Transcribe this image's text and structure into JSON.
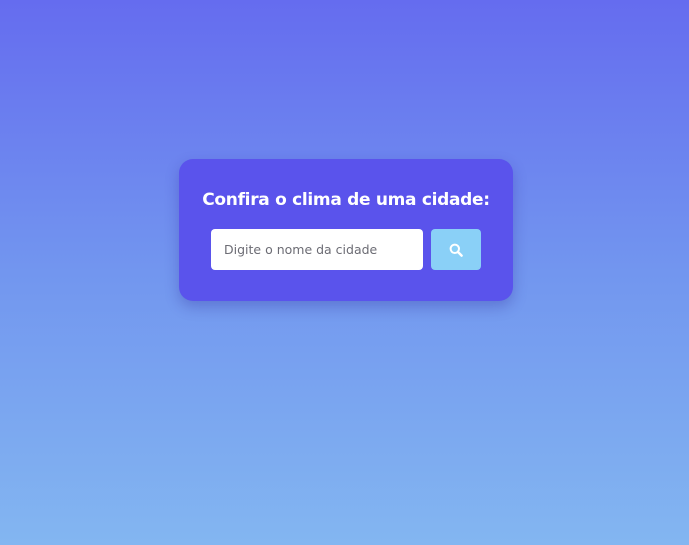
{
  "search_card": {
    "title": "Confira o clima de uma cidade:",
    "input_placeholder": "Digite o nome da cidade",
    "input_value": "",
    "button_icon": "search-icon"
  },
  "colors": {
    "background_top": "#656cef",
    "background_bottom": "#83b6f1",
    "card": "#5a53ec",
    "button": "#8ad0f7",
    "title_text": "#ffffff"
  }
}
